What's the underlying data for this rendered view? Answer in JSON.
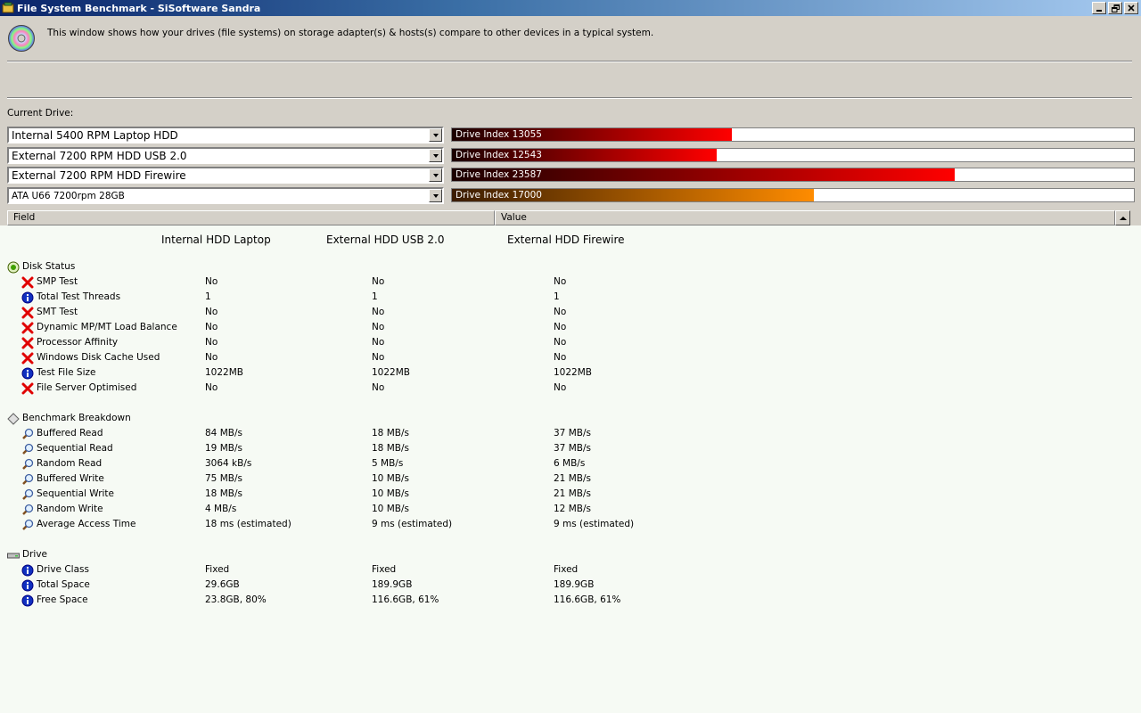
{
  "window": {
    "title": "File System Benchmark - SiSoftware Sandra",
    "info_text": "This window shows how your drives (file systems) on storage adapter(s) & hosts(s) compare to other devices in a typical system."
  },
  "current_drive_label": "Current Drive:",
  "drives": [
    {
      "name": "Internal 5400 RPM Laptop HDD",
      "bar_label": "Drive Index 13055",
      "fill_fraction": 0.41,
      "color": "red"
    },
    {
      "name": "External 7200 RPM HDD USB 2.0",
      "bar_label": "Drive Index 12543",
      "fill_fraction": 0.388,
      "color": "red"
    },
    {
      "name": "External 7200 RPM HDD Firewire",
      "bar_label": "Drive Index 23587",
      "fill_fraction": 0.737,
      "color": "red"
    },
    {
      "name": "ATA U66 7200rpm 28GB",
      "bar_label": "Drive Index 17000",
      "fill_fraction": 0.531,
      "color": "orange"
    }
  ],
  "columns": {
    "field": "Field",
    "value": "Value"
  },
  "report_headers": [
    "Internal HDD Laptop",
    "External HDD USB 2.0",
    "External HDD Firewire"
  ],
  "sections": [
    {
      "title": "Disk Status",
      "icon": "green-disc-icon",
      "rows": [
        {
          "label": "SMP Test",
          "icon": "red-x-icon",
          "values": [
            "No",
            "No",
            "No"
          ]
        },
        {
          "label": "Total Test Threads",
          "icon": "info-icon",
          "values": [
            "1",
            "1",
            "1"
          ]
        },
        {
          "label": "SMT Test",
          "icon": "red-x-icon",
          "values": [
            "No",
            "No",
            "No"
          ]
        },
        {
          "label": "Dynamic MP/MT Load Balance",
          "icon": "red-x-icon",
          "values": [
            "No",
            "No",
            "No"
          ]
        },
        {
          "label": "Processor Affinity",
          "icon": "red-x-icon",
          "values": [
            "No",
            "No",
            "No"
          ]
        },
        {
          "label": "Windows Disk Cache Used",
          "icon": "red-x-icon",
          "values": [
            "No",
            "No",
            "No"
          ]
        },
        {
          "label": "Test File Size",
          "icon": "info-icon",
          "values": [
            "1022MB",
            "1022MB",
            "1022MB"
          ]
        },
        {
          "label": "File Server Optimised",
          "icon": "red-x-icon",
          "values": [
            "No",
            "No",
            "No"
          ]
        }
      ]
    },
    {
      "title": "Benchmark Breakdown",
      "icon": "diamond-icon",
      "rows": [
        {
          "label": "Buffered Read",
          "icon": "magnifier-icon",
          "values": [
            "84 MB/s",
            "18 MB/s",
            "37 MB/s"
          ]
        },
        {
          "label": "Sequential Read",
          "icon": "magnifier-icon",
          "values": [
            "19 MB/s",
            "18 MB/s",
            "37 MB/s"
          ]
        },
        {
          "label": "Random Read",
          "icon": "magnifier-icon",
          "values": [
            "3064 kB/s",
            "5 MB/s",
            "6 MB/s"
          ]
        },
        {
          "label": "Buffered Write",
          "icon": "magnifier-icon",
          "values": [
            "75 MB/s",
            "10 MB/s",
            "21 MB/s"
          ]
        },
        {
          "label": "Sequential Write",
          "icon": "magnifier-icon",
          "values": [
            "18 MB/s",
            "10 MB/s",
            "21 MB/s"
          ]
        },
        {
          "label": "Random Write",
          "icon": "magnifier-icon",
          "values": [
            "4 MB/s",
            "10 MB/s",
            "12 MB/s"
          ]
        },
        {
          "label": "Average Access Time",
          "icon": "magnifier-icon",
          "values": [
            "18 ms (estimated)",
            "9 ms (estimated)",
            "9 ms (estimated)"
          ]
        }
      ]
    },
    {
      "title": "Drive",
      "icon": "drive-icon",
      "rows": [
        {
          "label": "Drive Class",
          "icon": "info-icon",
          "values": [
            "Fixed",
            "Fixed",
            "Fixed"
          ]
        },
        {
          "label": "Total Space",
          "icon": "info-icon",
          "values": [
            "29.6GB",
            "189.9GB",
            "189.9GB"
          ]
        },
        {
          "label": "Free Space",
          "icon": "info-icon",
          "values": [
            "23.8GB, 80%",
            "116.6GB, 61%",
            "116.6GB, 61%"
          ]
        }
      ]
    }
  ]
}
